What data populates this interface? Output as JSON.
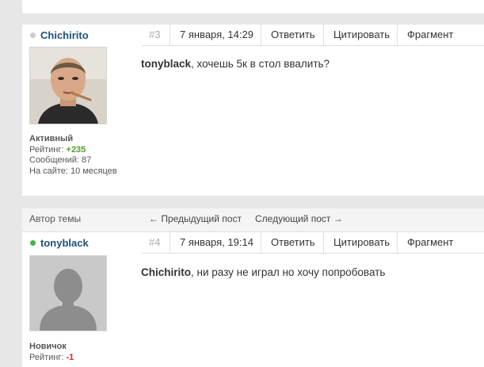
{
  "posts": [
    {
      "number": "#3",
      "date": "7 января, 14:29",
      "reply_label": "Ответить",
      "quote_label": "Цитировать",
      "fragment_label": "Фрагмент",
      "author": "Chichirito",
      "online": false,
      "status": "Активный",
      "rating_label": "Рейтинг:",
      "rating_value": "+235",
      "messages_label": "Сообщений:",
      "messages_value": "87",
      "onsite_label": "На сайте:",
      "onsite_value": "10 месяцев",
      "mention": "tonyblack",
      "text": ", хочешь 5к в стол ввалить?"
    },
    {
      "number": "#4",
      "date": "7 января, 19:14",
      "reply_label": "Ответить",
      "quote_label": "Цитировать",
      "fragment_label": "Фрагмент",
      "author": "tonyblack",
      "online": true,
      "status": "Новичок",
      "rating_label": "Рейтинг:",
      "rating_value": "-1",
      "mention": "Chichirito",
      "text": ", ни разу не играл но хочу попробовать"
    }
  ],
  "divider": {
    "topic_author": "Автор темы",
    "prev_post": "← Предыдущий пост",
    "next_post": "Следующий пост →"
  },
  "colors": {
    "author_link": "#1d4f7d",
    "online_dot": "#4caf50",
    "offline_dot": "#cccccc",
    "rating_positive": "#4f9a2d",
    "rating_negative": "#dd2222"
  }
}
